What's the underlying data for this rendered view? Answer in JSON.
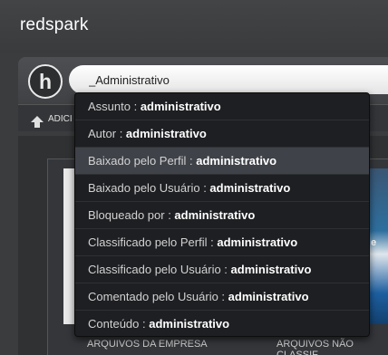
{
  "app": {
    "brand": "redspark"
  },
  "search": {
    "value": "_Administrativo"
  },
  "toolbar": {
    "add_label": "ADICI"
  },
  "suggestions": [
    {
      "field": "Assunto",
      "term": "administrativo"
    },
    {
      "field": "Autor",
      "term": "administrativo"
    },
    {
      "field": "Baixado pelo Perfil",
      "term": "administrativo"
    },
    {
      "field": "Baixado pelo Usuário",
      "term": "administrativo"
    },
    {
      "field": "Bloqueado por",
      "term": "administrativo"
    },
    {
      "field": "Classificado pelo Perfil",
      "term": "administrativo"
    },
    {
      "field": "Classificado pelo Usuário",
      "term": "administrativo"
    },
    {
      "field": "Comentado pelo Usuário",
      "term": "administrativo"
    },
    {
      "field": "Conteúdo",
      "term": "administrativo"
    }
  ],
  "sep": " : ",
  "highlighted_index": 2,
  "background": {
    "card_right_text": "e",
    "label_left": "ARQUIVOS DA EMPRESA",
    "label_right": "ARQUIVOS NÃO CLASSIF"
  },
  "colors": {
    "topbar": "#3a3c3e",
    "dropdown_bg": "#1e1f22",
    "dropdown_highlight": "#3f4249",
    "text": "#d2d2d2"
  },
  "icons": {
    "logo": "h-circle-logo",
    "add": "upload-arrow-icon"
  }
}
